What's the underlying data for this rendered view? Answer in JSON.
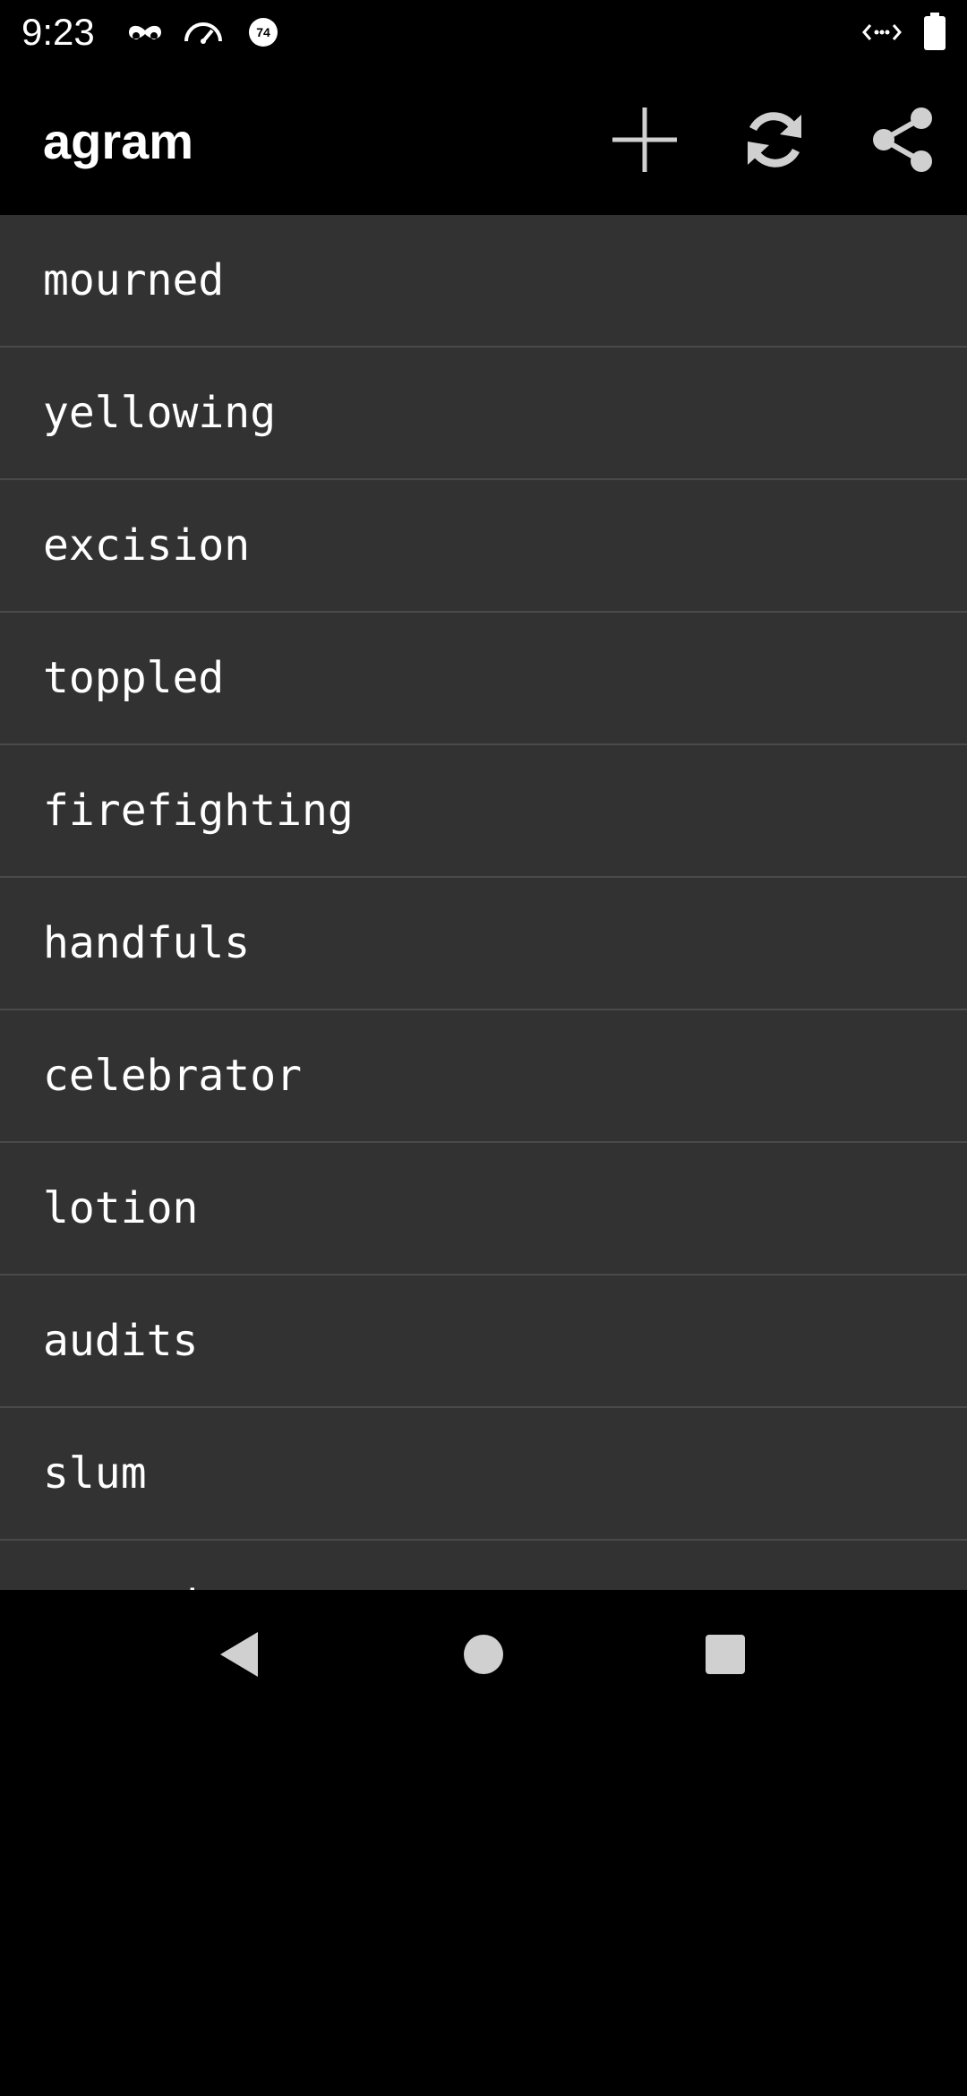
{
  "status_bar": {
    "time": "9:23",
    "icons": [
      "incognito-icon",
      "speedometer-icon",
      "badge-74-icon",
      "data-transfer-icon",
      "battery-icon"
    ],
    "badge_text": "74"
  },
  "app_bar": {
    "title": "agram",
    "actions": [
      "add-icon",
      "refresh-icon",
      "share-icon"
    ]
  },
  "list": {
    "items": [
      {
        "label": "mourned"
      },
      {
        "label": "yellowing"
      },
      {
        "label": "excision"
      },
      {
        "label": "toppled"
      },
      {
        "label": "firefighting"
      },
      {
        "label": "handfuls"
      },
      {
        "label": "celebrator"
      },
      {
        "label": "lotion"
      },
      {
        "label": "audits"
      },
      {
        "label": "slum"
      },
      {
        "label": "seeped"
      }
    ]
  },
  "nav_bar": {
    "buttons": [
      "back-icon",
      "home-icon",
      "recents-icon"
    ]
  },
  "colors": {
    "background": "#000000",
    "list_background": "#323232",
    "divider": "#4a4a4a",
    "text": "#ffffff",
    "icon": "#d0d0d0"
  }
}
